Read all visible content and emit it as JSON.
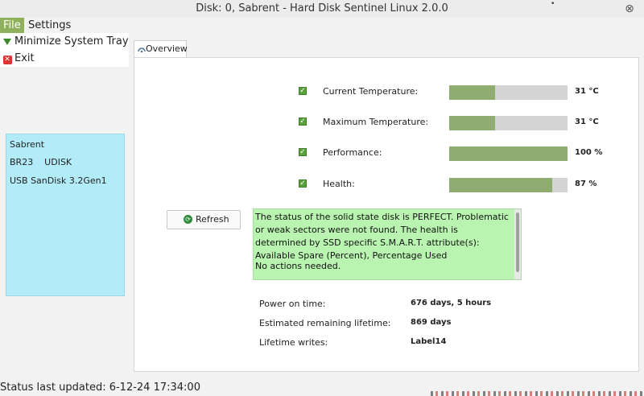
{
  "window": {
    "title": "Disk: 0, Sabrent - Hard Disk Sentinel Linux 2.0.0",
    "close_glyph": "⊗"
  },
  "menubar": {
    "file": "File",
    "settings": "Settings"
  },
  "file_menu": {
    "items": [
      {
        "label": "Minimize System Tray",
        "icon": "green-down-triangle-icon"
      },
      {
        "label": "Exit",
        "icon": "red-x-icon"
      }
    ]
  },
  "disk_panel": {
    "name": "Sabrent",
    "line2": "BR23    UDISK",
    "line3": "USB SanDisk 3.2Gen1"
  },
  "tabs": [
    {
      "label": "Overview",
      "icon": "overview-icon",
      "active": true
    }
  ],
  "metrics": [
    {
      "label": "Current Temperature:",
      "value": "31 °C",
      "fill_percent": 39
    },
    {
      "label": "Maximum Temperature:",
      "value": "31 °C",
      "fill_percent": 39
    },
    {
      "label": "Performance:",
      "value": "100 %",
      "fill_percent": 100
    },
    {
      "label": "Health:",
      "value": "87 %",
      "fill_percent": 87
    }
  ],
  "refresh": {
    "label": "Refresh",
    "icon": "refresh-icon"
  },
  "status_message": {
    "text": "The status of the solid state disk is PERFECT. Problematic or weak sectors were not found.  The health is determined by SSD specific S.M.A.R.T. attribute(s):  Available Spare (Percent), Percentage Used",
    "action": "No actions needed."
  },
  "info": [
    {
      "label": "Power on time:",
      "value": "676 days, 5 hours"
    },
    {
      "label": "Estimated remaining lifetime:",
      "value": "869 days"
    },
    {
      "label": "Lifetime writes:",
      "value": "Label14"
    }
  ],
  "status_bar": {
    "text": "Status last updated: 6-12-24 17:34:00"
  },
  "colors": {
    "accent": "#8fb05c",
    "bar_fill": "#8fad70",
    "bar_track": "#d4d4d4",
    "status_bg": "#b9f5b0",
    "disk_panel_bg": "#b2ecf8"
  }
}
